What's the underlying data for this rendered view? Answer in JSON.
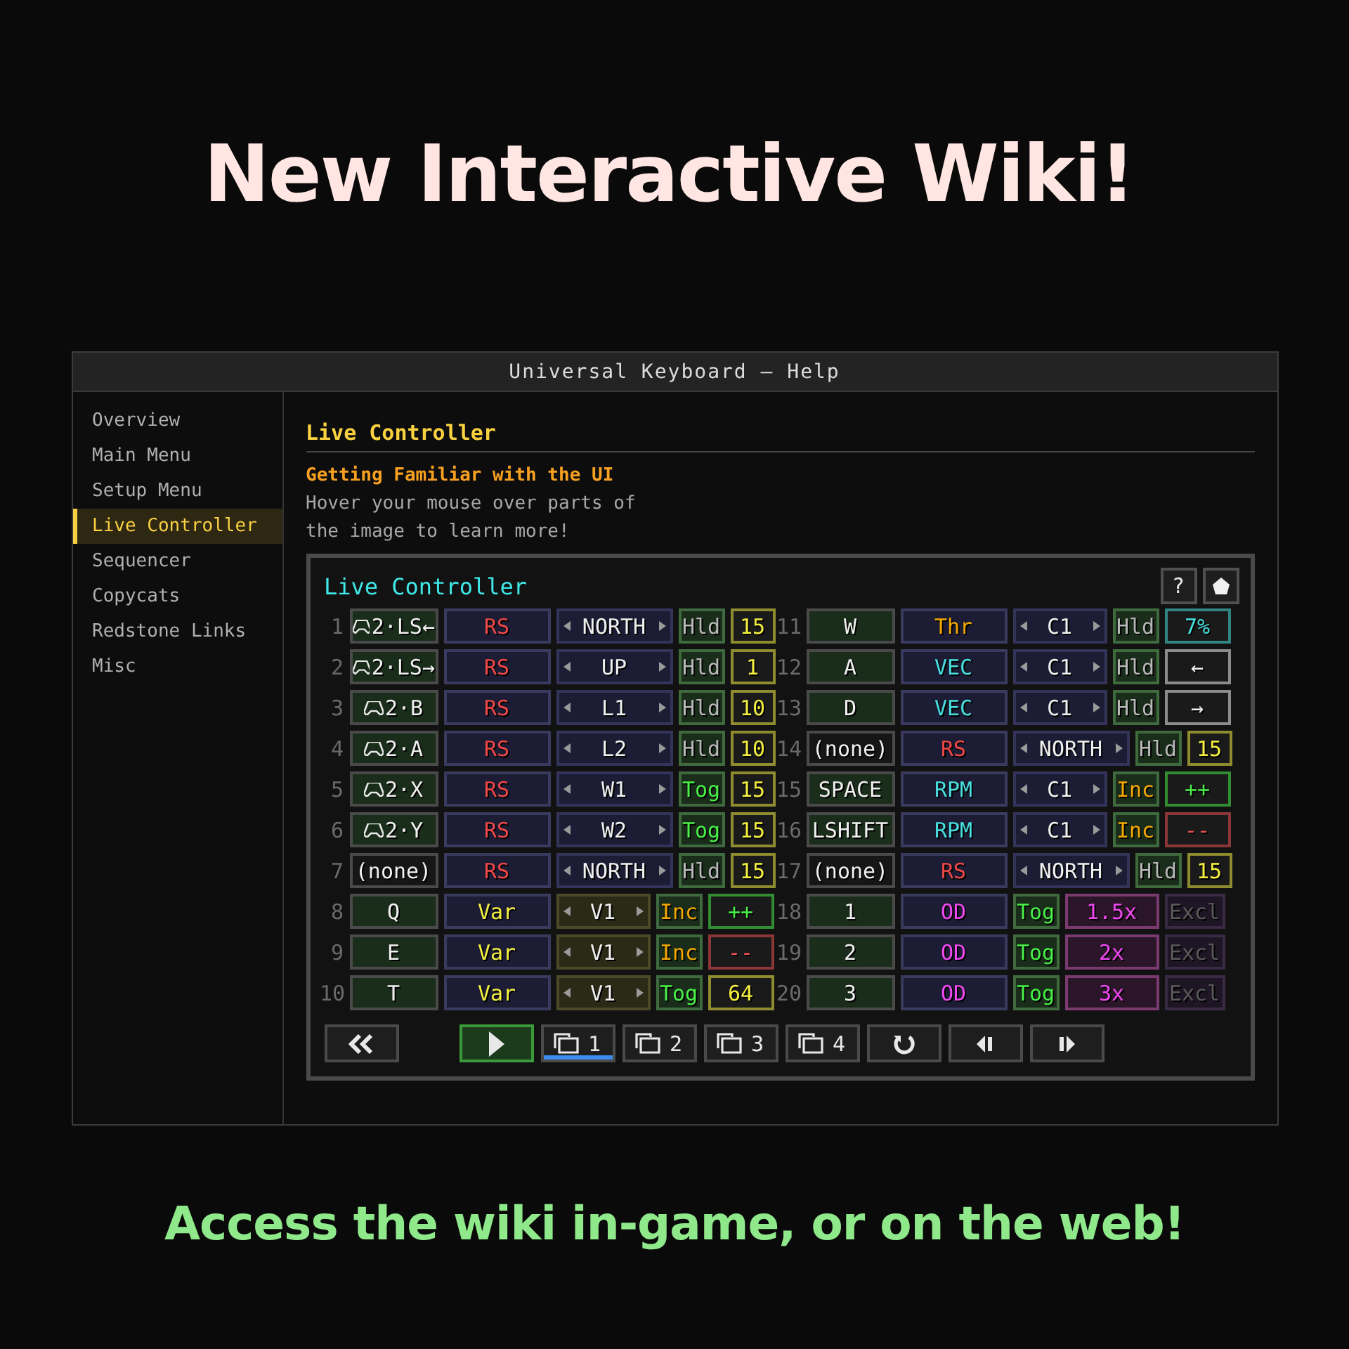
{
  "headline": "New Interactive Wiki!",
  "window": {
    "title": "Universal Keyboard — Help"
  },
  "sidebar": {
    "items": [
      {
        "label": "Overview",
        "selected": false
      },
      {
        "label": "Main Menu",
        "selected": false
      },
      {
        "label": "Setup Menu",
        "selected": false
      },
      {
        "label": "Live Controller",
        "selected": true
      },
      {
        "label": "Sequencer",
        "selected": false
      },
      {
        "label": "Copycats",
        "selected": false
      },
      {
        "label": "Redstone Links",
        "selected": false
      },
      {
        "label": "Misc",
        "selected": false
      }
    ]
  },
  "content": {
    "heading": "Live Controller",
    "subheading": "Getting Familiar with the UI",
    "paragraph": "Hover your mouse over parts of\nthe image to learn more!"
  },
  "controller": {
    "title": "Live Controller",
    "help": "?",
    "halves": [
      [
        {
          "number": "1",
          "kind": "signal",
          "key": {
            "text": "2·LS←",
            "gamepad": true
          },
          "type": {
            "text": "RS",
            "color": "#f04848"
          },
          "target": "NORTH",
          "mode": {
            "text": "Hld",
            "color": "#b8b8b8"
          },
          "value": {
            "text": "15",
            "color": "#f4f040"
          }
        },
        {
          "number": "2",
          "kind": "signal",
          "key": {
            "text": "2·LS→",
            "gamepad": true
          },
          "type": {
            "text": "RS",
            "color": "#f04848"
          },
          "target": "UP",
          "mode": {
            "text": "Hld",
            "color": "#b8b8b8"
          },
          "value": {
            "text": "1",
            "color": "#f4f040"
          }
        },
        {
          "number": "3",
          "kind": "signal",
          "key": {
            "text": "2·B",
            "gamepad": true
          },
          "type": {
            "text": "RS",
            "color": "#f04848"
          },
          "target": "L1",
          "mode": {
            "text": "Hld",
            "color": "#b8b8b8"
          },
          "value": {
            "text": "10",
            "color": "#f4f040"
          }
        },
        {
          "number": "4",
          "kind": "signal",
          "key": {
            "text": "2·A",
            "gamepad": true
          },
          "type": {
            "text": "RS",
            "color": "#f04848"
          },
          "target": "L2",
          "mode": {
            "text": "Hld",
            "color": "#b8b8b8"
          },
          "value": {
            "text": "10",
            "color": "#f4f040"
          }
        },
        {
          "number": "5",
          "kind": "signal",
          "key": {
            "text": "2·X",
            "gamepad": true
          },
          "type": {
            "text": "RS",
            "color": "#f04848"
          },
          "target": "W1",
          "mode": {
            "text": "Tog",
            "color": "#48f048"
          },
          "value": {
            "text": "15",
            "color": "#f4f040"
          }
        },
        {
          "number": "6",
          "kind": "signal",
          "key": {
            "text": "2·Y",
            "gamepad": true
          },
          "type": {
            "text": "RS",
            "color": "#f04848"
          },
          "target": "W2",
          "mode": {
            "text": "Tog",
            "color": "#48f048"
          },
          "value": {
            "text": "15",
            "color": "#f4f040"
          }
        },
        {
          "number": "7",
          "kind": "signal",
          "key": {
            "text": "(none)",
            "gamepad": false
          },
          "type": {
            "text": "RS",
            "color": "#f04848"
          },
          "target": "NORTH",
          "mode": {
            "text": "Hld",
            "color": "#b8b8b8"
          },
          "value": {
            "text": "15",
            "color": "#f4f040"
          }
        },
        {
          "number": "8",
          "kind": "variable",
          "key": {
            "text": "Q",
            "gamepad": false
          },
          "type": {
            "text": "Var",
            "color": "#f4f040"
          },
          "target": "V1",
          "mode": {
            "text": "Inc",
            "color": "#f4a800"
          },
          "value": {
            "text": "++",
            "color": "#48f048"
          }
        },
        {
          "number": "9",
          "kind": "variable",
          "key": {
            "text": "E",
            "gamepad": false
          },
          "type": {
            "text": "Var",
            "color": "#f4f040"
          },
          "target": "V1",
          "mode": {
            "text": "Inc",
            "color": "#f4a800"
          },
          "value": {
            "text": "--",
            "color": "#f05050"
          }
        },
        {
          "number": "10",
          "kind": "variable",
          "key": {
            "text": "T",
            "gamepad": false
          },
          "type": {
            "text": "Var",
            "color": "#f4f040"
          },
          "target": "V1",
          "mode": {
            "text": "Tog",
            "color": "#48f048"
          },
          "value": {
            "text": "64",
            "color": "#f4f040"
          }
        }
      ],
      [
        {
          "number": "11",
          "kind": "controller",
          "key": {
            "text": "W",
            "gamepad": false
          },
          "type": {
            "text": "Thr",
            "color": "#f4a800"
          },
          "target": "C1",
          "mode": {
            "text": "Hld",
            "color": "#b8b8b8"
          },
          "value": {
            "text": "7%",
            "color": "#48e0e0"
          }
        },
        {
          "number": "12",
          "kind": "controller",
          "key": {
            "text": "A",
            "gamepad": false
          },
          "type": {
            "text": "VEC",
            "color": "#48e0e0"
          },
          "target": "C1",
          "mode": {
            "text": "Hld",
            "color": "#b8b8b8"
          },
          "value": {
            "text": "←",
            "color": "#f0f0f0"
          }
        },
        {
          "number": "13",
          "kind": "controller",
          "key": {
            "text": "D",
            "gamepad": false
          },
          "type": {
            "text": "VEC",
            "color": "#48e0e0"
          },
          "target": "C1",
          "mode": {
            "text": "Hld",
            "color": "#b8b8b8"
          },
          "value": {
            "text": "→",
            "color": "#f0f0f0"
          }
        },
        {
          "number": "14",
          "kind": "signal",
          "key": {
            "text": "(none)",
            "gamepad": false
          },
          "type": {
            "text": "RS",
            "color": "#f04848"
          },
          "target": "NORTH",
          "mode": {
            "text": "Hld",
            "color": "#b8b8b8"
          },
          "value": {
            "text": "15",
            "color": "#f4f040"
          }
        },
        {
          "number": "15",
          "kind": "controller",
          "key": {
            "text": "SPACE",
            "gamepad": false
          },
          "type": {
            "text": "RPM",
            "color": "#48e0e0"
          },
          "target": "C1",
          "mode": {
            "text": "Inc",
            "color": "#f4a800"
          },
          "value": {
            "text": "++",
            "color": "#48f048"
          }
        },
        {
          "number": "16",
          "kind": "controller",
          "key": {
            "text": "LSHIFT",
            "gamepad": false
          },
          "type": {
            "text": "RPM",
            "color": "#48e0e0"
          },
          "target": "C1",
          "mode": {
            "text": "Inc",
            "color": "#f4a800"
          },
          "value": {
            "text": "--",
            "color": "#f05050"
          }
        },
        {
          "number": "17",
          "kind": "signal",
          "key": {
            "text": "(none)",
            "gamepad": false
          },
          "type": {
            "text": "RS",
            "color": "#f04848"
          },
          "target": "NORTH",
          "mode": {
            "text": "Hld",
            "color": "#b8b8b8"
          },
          "value": {
            "text": "15",
            "color": "#f4f040"
          }
        },
        {
          "number": "18",
          "kind": "overdrive",
          "key": {
            "text": "1",
            "gamepad": false
          },
          "type": {
            "text": "OD",
            "color": "#f048f0"
          },
          "mode": {
            "text": "Tog",
            "color": "#48f048"
          },
          "value": {
            "text": "1.5x",
            "color": "#f048f0"
          },
          "extra": {
            "text": "Excl",
            "disabled": true
          }
        },
        {
          "number": "19",
          "kind": "overdrive",
          "key": {
            "text": "2",
            "gamepad": false
          },
          "type": {
            "text": "OD",
            "color": "#f048f0"
          },
          "mode": {
            "text": "Tog",
            "color": "#48f048"
          },
          "value": {
            "text": "2x",
            "color": "#f048f0"
          },
          "extra": {
            "text": "Excl",
            "disabled": true
          }
        },
        {
          "number": "20",
          "kind": "overdrive",
          "key": {
            "text": "3",
            "gamepad": false
          },
          "type": {
            "text": "OD",
            "color": "#f048f0"
          },
          "mode": {
            "text": "Tog",
            "color": "#48f048"
          },
          "value": {
            "text": "3x",
            "color": "#f048f0"
          },
          "extra": {
            "text": "Excl",
            "disabled": true
          }
        }
      ]
    ],
    "toolbar": [
      {
        "kind": "back"
      },
      {
        "kind": "play",
        "on": true
      },
      {
        "kind": "page",
        "label": "1",
        "selected": true
      },
      {
        "kind": "page",
        "label": "2",
        "selected": false
      },
      {
        "kind": "page",
        "label": "3",
        "selected": false
      },
      {
        "kind": "page",
        "label": "4",
        "selected": false
      },
      {
        "kind": "reset"
      },
      {
        "kind": "prev"
      },
      {
        "kind": "next"
      }
    ]
  },
  "footer": "Access the wiki in-game, or on the web!"
}
